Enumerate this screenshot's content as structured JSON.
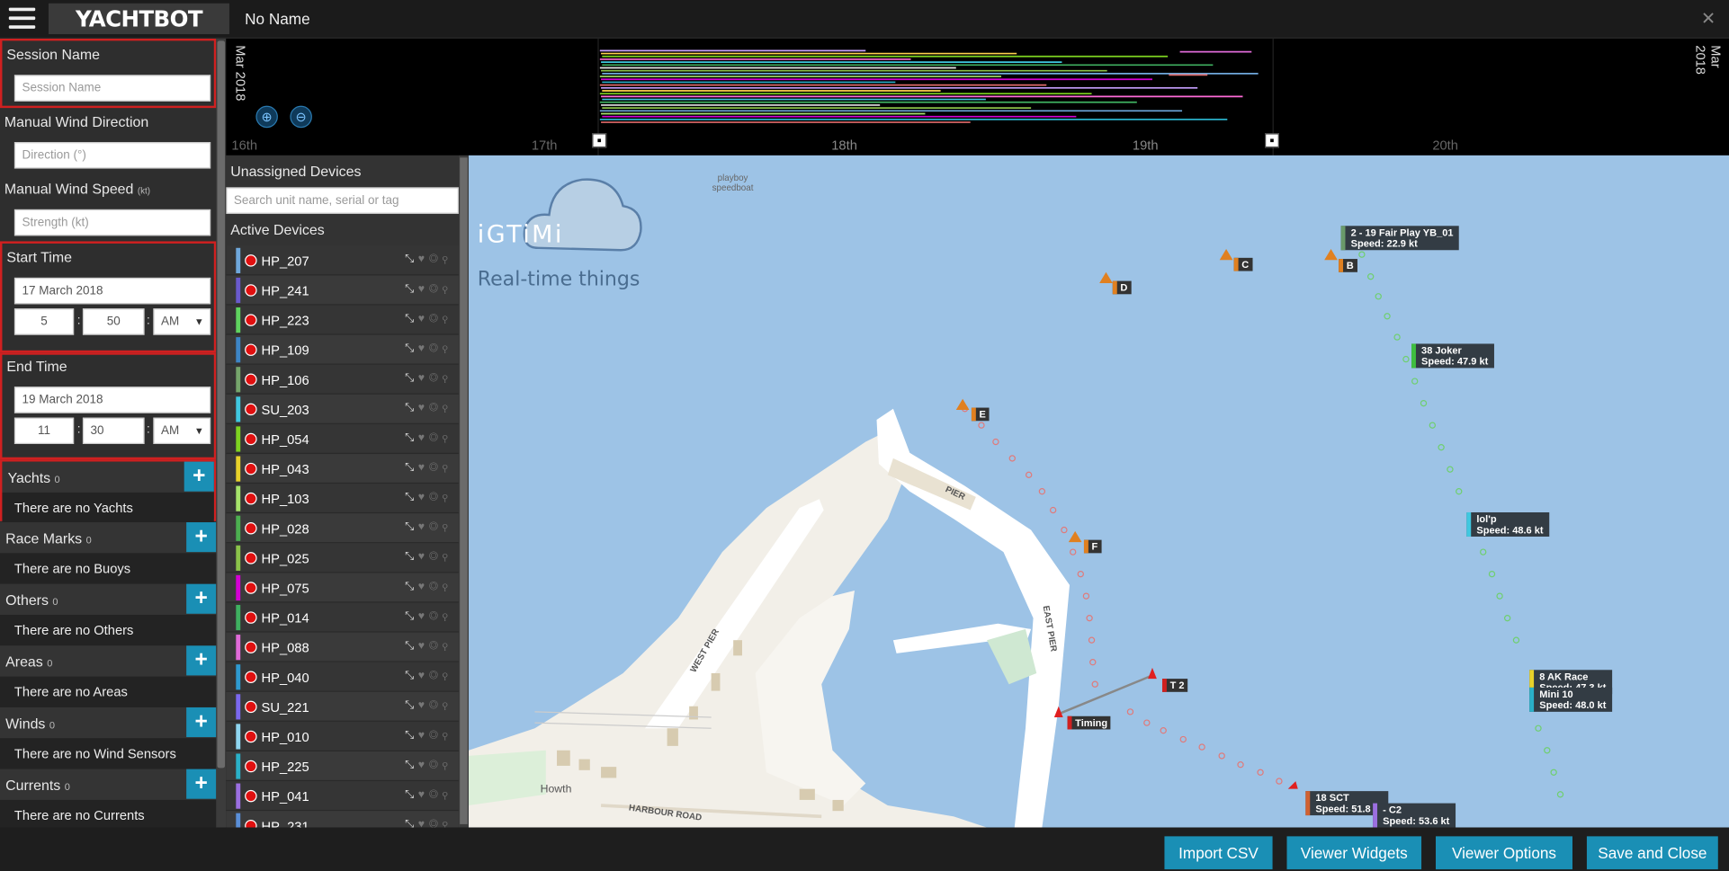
{
  "app": {
    "brand": "YACHTBOT",
    "document_title": "No Name",
    "close_glyph": "✕"
  },
  "session": {
    "session_name_label": "Session Name",
    "session_name_placeholder": "Session Name",
    "wind_dir_label": "Manual Wind Direction",
    "wind_dir_placeholder": "Direction (°)",
    "wind_speed_label": "Manual Wind Speed",
    "wind_speed_unit": "(kt)",
    "wind_speed_placeholder": "Strength (kt)",
    "start_label": "Start Time",
    "start_date": "17 March 2018",
    "start_hour": "5",
    "start_minute": "50",
    "start_ampm": "AM",
    "end_label": "End Time",
    "end_date": "19 March 2018",
    "end_hour": "11",
    "end_minute": "30",
    "end_ampm": "AM"
  },
  "categories": [
    {
      "title": "Yachts",
      "count": "0",
      "empty": "There are no Yachts"
    },
    {
      "title": "Race Marks",
      "count": "0",
      "empty": "There are no Buoys"
    },
    {
      "title": "Others",
      "count": "0",
      "empty": "There are no Others"
    },
    {
      "title": "Areas",
      "count": "0",
      "empty": "There are no Areas"
    },
    {
      "title": "Winds",
      "count": "0",
      "empty": "There are no Wind Sensors"
    },
    {
      "title": "Currents",
      "count": "0",
      "empty": "There are no Currents"
    }
  ],
  "timeline": {
    "left_date": "Mar 2018",
    "right_date": "Mar 2018",
    "ticks": [
      "16th",
      "17th",
      "18th",
      "19th",
      "20th"
    ],
    "zoom_in_icon": "zoom-in-icon",
    "zoom_out_icon": "zoom-out-icon"
  },
  "devices": {
    "unassigned_title": "Unassigned Devices",
    "search_placeholder": "Search unit name, serial or tag",
    "active_title": "Active Devices",
    "list": [
      {
        "name": "HP_207",
        "color": "#6fa8dc"
      },
      {
        "name": "HP_241",
        "color": "#6a5acd"
      },
      {
        "name": "HP_223",
        "color": "#5fd35f"
      },
      {
        "name": "HP_109",
        "color": "#3d85c6"
      },
      {
        "name": "HP_106",
        "color": "#76a56c"
      },
      {
        "name": "SU_203",
        "color": "#40c8e0"
      },
      {
        "name": "HP_054",
        "color": "#7ed321"
      },
      {
        "name": "HP_043",
        "color": "#e8d22a"
      },
      {
        "name": "HP_103",
        "color": "#a6e36b"
      },
      {
        "name": "HP_028",
        "color": "#4caf50"
      },
      {
        "name": "HP_025",
        "color": "#8bc34a"
      },
      {
        "name": "HP_075",
        "color": "#d400d4"
      },
      {
        "name": "HP_014",
        "color": "#3fb060"
      },
      {
        "name": "HP_088",
        "color": "#e06bd8"
      },
      {
        "name": "HP_040",
        "color": "#2e9ad0"
      },
      {
        "name": "SU_221",
        "color": "#7b68ee"
      },
      {
        "name": "HP_010",
        "color": "#8fd6f0"
      },
      {
        "name": "HP_225",
        "color": "#2ab0c8"
      },
      {
        "name": "HP_041",
        "color": "#9b6fe0"
      },
      {
        "name": "HP_231",
        "color": "#5a8fd8"
      }
    ]
  },
  "map": {
    "logo_brand": "iGTiMi",
    "logo_tag": "Real-time things",
    "playboy_label": "playboy speedboat",
    "marks": [
      {
        "label": "C"
      },
      {
        "label": "B"
      },
      {
        "label": "D"
      },
      {
        "label": "E"
      },
      {
        "label": "F"
      },
      {
        "label": "T 2"
      },
      {
        "label": "Timing"
      }
    ],
    "boats": [
      {
        "name": "2 - 19 Fair Play YB_01",
        "speed": "Speed: 22.9 kt"
      },
      {
        "name": "38 Joker",
        "speed": "Speed: 47.9 kt"
      },
      {
        "name": "lol'p",
        "speed": "Speed: 48.6 kt"
      },
      {
        "name": "8 AK Race",
        "speed": "Speed: 47.3 kt"
      },
      {
        "name": "Mini 10",
        "speed": "Speed: 48.0 kt"
      },
      {
        "name": "18 SCT",
        "speed": "Speed: 51.8 kt"
      },
      {
        "name": "- C2",
        "speed": "Speed: 53.6 kt"
      }
    ],
    "streets": [
      "PIER",
      "WEST PIER",
      "EAST PIER",
      "Howth",
      "HARBOUR ROAD"
    ]
  },
  "buttons": {
    "import": "Import CSV",
    "widgets": "Viewer Widgets",
    "options": "Viewer Options",
    "save": "Save and Close"
  },
  "colors": {
    "accent": "#1a8fb5",
    "highlight_border": "#d02020",
    "sea": "#9dc3e6",
    "mark": "#e08020"
  }
}
